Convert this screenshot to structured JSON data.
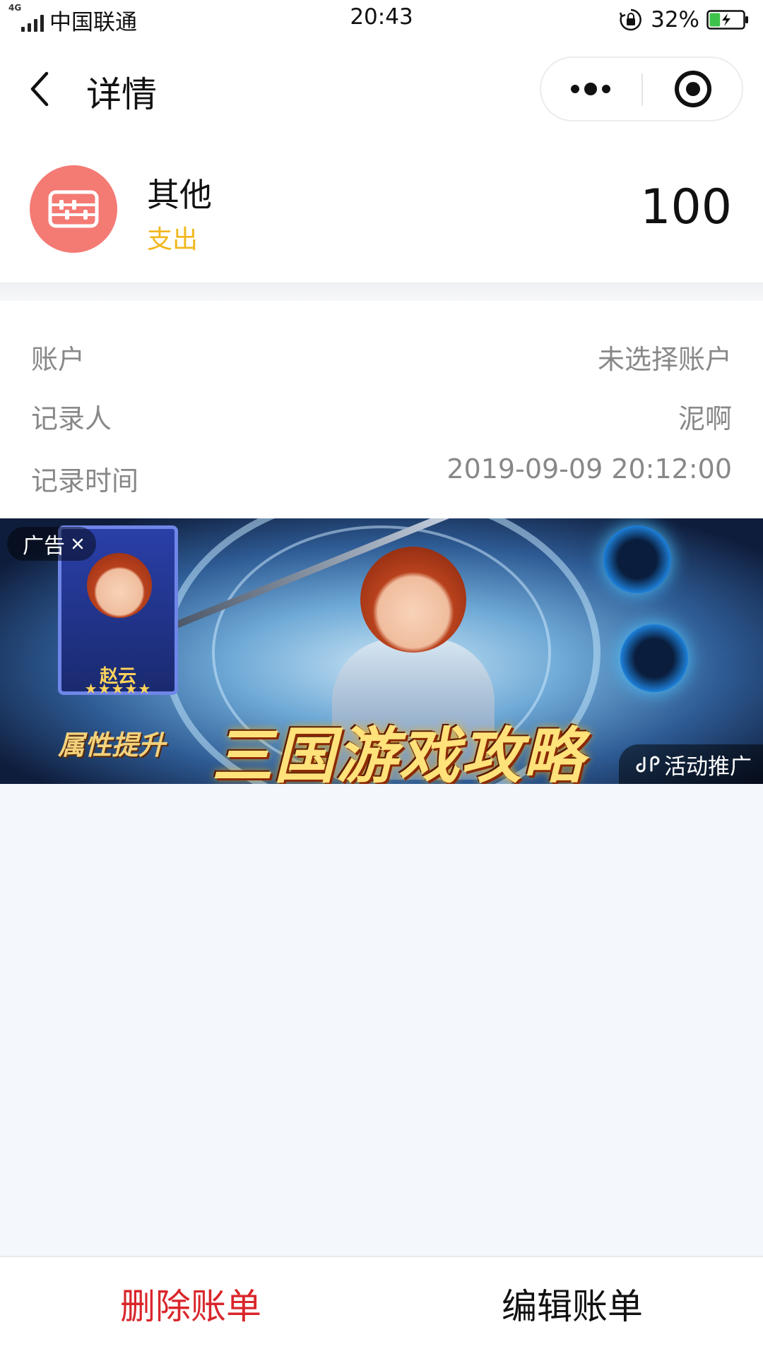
{
  "status_bar": {
    "network": "4G",
    "carrier": "中国联通",
    "time": "20:43",
    "battery": "32%",
    "battery_level": 0.32,
    "icons": [
      "signal-icon",
      "rotation-lock-icon",
      "battery-charging-icon"
    ]
  },
  "nav": {
    "title": "详情",
    "icons": [
      "back-chevron-icon",
      "more-dots-icon",
      "close-target-icon"
    ]
  },
  "record": {
    "category": "其他",
    "type": "支出",
    "amount": "100",
    "icon": "abacus-icon",
    "icon_color": "#f47a74",
    "type_color": "#f1b81d"
  },
  "details": [
    {
      "label": "账户",
      "value": "未选择账户"
    },
    {
      "label": "记录人",
      "value": "泥啊"
    },
    {
      "label": "记录时间",
      "value": "2019-09-09 20:12:00"
    }
  ],
  "ad": {
    "tag": "广告",
    "card_name": "赵云",
    "card_stars": "★★★★★",
    "attr_text": "属性提升",
    "headline": "三国游戏攻略",
    "promo": "活动推广",
    "icons": [
      "close-icon",
      "mini-program-icon"
    ]
  },
  "actions": {
    "delete": "删除账单",
    "edit": "编辑账单",
    "delete_color": "#d9262b"
  }
}
